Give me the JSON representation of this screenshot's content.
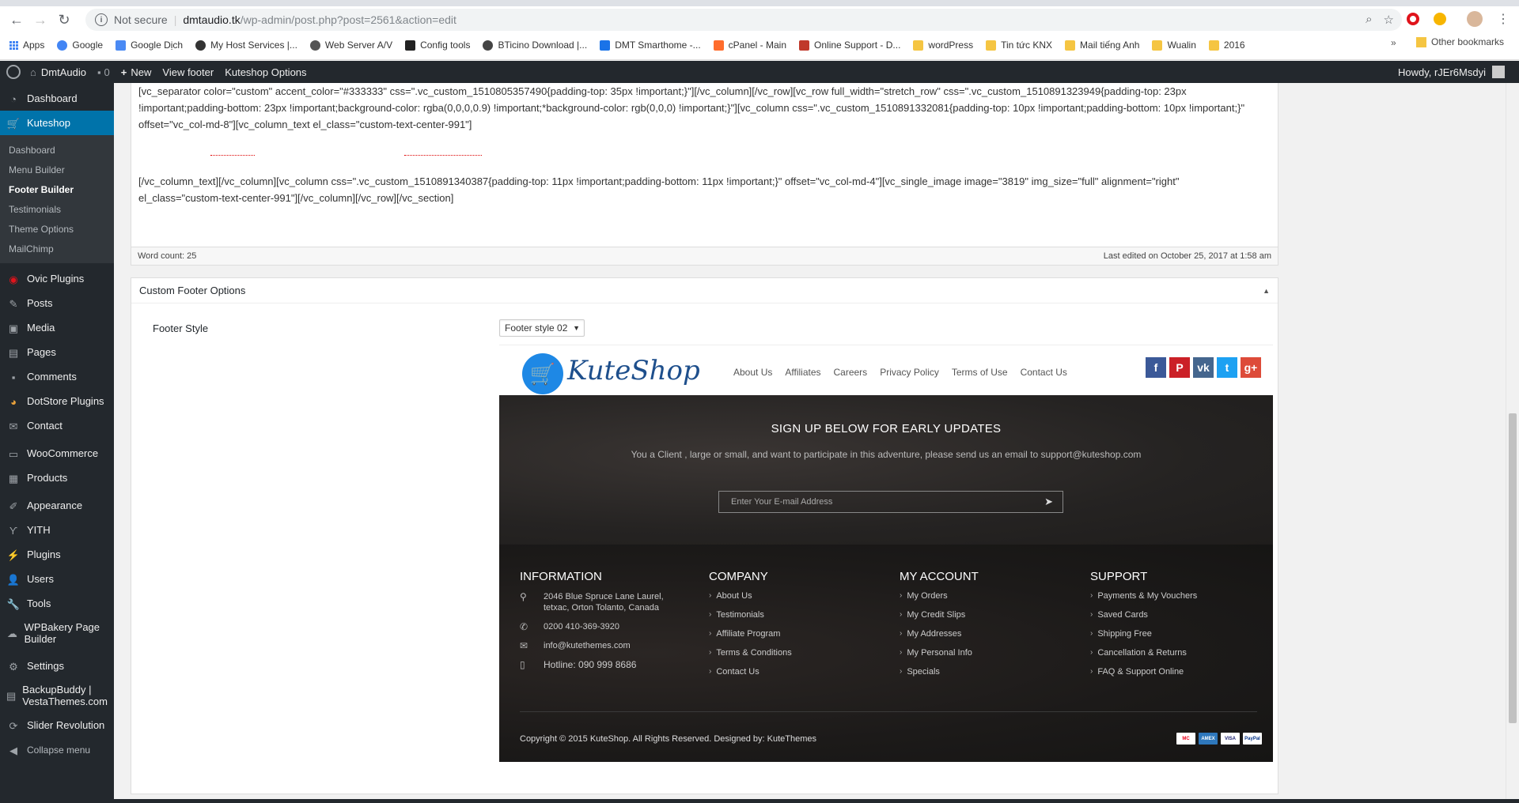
{
  "browser": {
    "security_label": "Not secure",
    "url_host": "dmtaudio.tk",
    "url_path": "/wp-admin/post.php?post=2561&action=edit",
    "bookmarks": [
      {
        "label": "Apps",
        "icon": "apps-grid-icon"
      },
      {
        "label": "Google",
        "icon": "google-icon"
      },
      {
        "label": "Google Dịch",
        "icon": "translate-icon"
      },
      {
        "label": "My Host Services |...",
        "icon": "host-icon"
      },
      {
        "label": "Web Server A/V",
        "icon": "server-icon"
      },
      {
        "label": "Config tools",
        "icon": "page-icon"
      },
      {
        "label": "BTicino Download |...",
        "icon": "bticino-icon"
      },
      {
        "label": "DMT Smarthome -...",
        "icon": "calendar-icon"
      },
      {
        "label": "cPanel - Main",
        "icon": "cpanel-icon"
      },
      {
        "label": "Online Support - D...",
        "icon": "support-icon"
      },
      {
        "label": "wordPress",
        "icon": "folder-icon"
      },
      {
        "label": "Tin tức KNX",
        "icon": "folder-icon"
      },
      {
        "label": "Mail tiếng Anh",
        "icon": "folder-icon"
      },
      {
        "label": "Wualin",
        "icon": "folder-icon"
      },
      {
        "label": "2016",
        "icon": "folder-icon"
      }
    ],
    "other_bookmarks": "Other bookmarks"
  },
  "adminbar": {
    "site_name": "DmtAudio",
    "comments_count": "0",
    "new_label": "New",
    "view_label": "View footer",
    "options_label": "Kuteshop Options",
    "howdy": "Howdy, rJEr6Msdyi"
  },
  "sidebar": {
    "items": [
      {
        "label": "Dashboard",
        "icon": "dashboard-icon"
      },
      {
        "label": "Kuteshop",
        "icon": "cart-icon",
        "active": true
      },
      {
        "label": "Ovic Plugins",
        "icon": "ovic-icon"
      },
      {
        "label": "Posts",
        "icon": "pin-icon"
      },
      {
        "label": "Media",
        "icon": "media-icon"
      },
      {
        "label": "Pages",
        "icon": "pages-icon"
      },
      {
        "label": "Comments",
        "icon": "comment-icon"
      },
      {
        "label": "DotStore Plugins",
        "icon": "dotstore-icon"
      },
      {
        "label": "Contact",
        "icon": "mail-icon"
      },
      {
        "label": "WooCommerce",
        "icon": "woo-icon"
      },
      {
        "label": "Products",
        "icon": "archive-icon"
      },
      {
        "label": "Appearance",
        "icon": "brush-icon"
      },
      {
        "label": "YITH",
        "icon": "yith-icon"
      },
      {
        "label": "Plugins",
        "icon": "plugin-icon"
      },
      {
        "label": "Users",
        "icon": "users-icon"
      },
      {
        "label": "Tools",
        "icon": "wrench-icon"
      },
      {
        "label": "WPBakery Page Builder",
        "icon": "cloud-icon"
      },
      {
        "label": "Settings",
        "icon": "settings-icon"
      },
      {
        "label": "BackupBuddy | VestaThemes.com",
        "icon": "backup-icon"
      },
      {
        "label": "Slider Revolution",
        "icon": "refresh-icon"
      },
      {
        "label": "Collapse menu",
        "icon": "collapse-icon"
      }
    ],
    "submenu": [
      {
        "label": "Dashboard"
      },
      {
        "label": "Menu Builder"
      },
      {
        "label": "Footer Builder",
        "current": true
      },
      {
        "label": "Testimonials"
      },
      {
        "label": "Theme Options"
      },
      {
        "label": "MailChimp"
      }
    ]
  },
  "editor": {
    "code_line1": "[vc_separator color=\"custom\" accent_color=\"#333333\" css=\".vc_custom_1510805357490{padding-top: 35px !important;}\"][/vc_column][/vc_row][vc_row full_width=\"stretch_row\" css=\".vc_custom_1510891323949{padding-top: 23px !important;padding-bottom: 23px !important;background-color: rgba(0,0,0,0.9) !important;*background-color: rgb(0,0,0) !important;}\"][vc_column css=\".vc_custom_1510891332081{padding-top: 10px !important;padding-bottom: 10px !important;}\" offset=\"vc_col-md-8\"][vc_column_text el_class=\"custom-text-center-991\"]",
    "code_line2": "[/vc_column_text][/vc_column][vc_column css=\".vc_custom_1510891340387{padding-top: 11px !important;padding-bottom: 11px !important;}\" offset=\"vc_col-md-4\"][vc_single_image image=\"3819\" img_size=\"full\" alignment=\"right\" el_class=\"custom-text-center-991\"][/vc_column][/vc_row][/vc_section]",
    "word_count": "Word count: 25",
    "last_edited": "Last edited on October 25, 2017 at 1:58 am"
  },
  "metabox": {
    "title": "Custom Footer Options",
    "field_label": "Footer Style",
    "select_value": "Footer style 02"
  },
  "preview": {
    "logo_text": "KuteShop",
    "links": [
      "About Us",
      "Affiliates",
      "Careers",
      "Privacy Policy",
      "Terms of Use",
      "Contact Us"
    ],
    "socials": [
      {
        "glyph": "f",
        "color": "#3b5998",
        "icon": "facebook-icon"
      },
      {
        "glyph": "P",
        "color": "#cb2027",
        "icon": "pinterest-icon"
      },
      {
        "glyph": "vk",
        "color": "#45668e",
        "icon": "vk-icon"
      },
      {
        "glyph": "t",
        "color": "#1da1f2",
        "icon": "twitter-icon"
      },
      {
        "glyph": "g+",
        "color": "#dd4b39",
        "icon": "google-plus-icon"
      }
    ],
    "signup_title": "SIGN UP BELOW FOR EARLY UPDATES",
    "signup_desc": "You a Client , large or small, and want to participate in this adventure, please send us an email to support@kuteshop.com",
    "email_placeholder": "Enter Your E-mail Address",
    "information": {
      "title": "INFORMATION",
      "address": "2046 Blue Spruce Lane Laurel, tetxac, Orton Tolanto, Canada",
      "phone": "0200 410-369-3920",
      "email": "info@kutethemes.com",
      "hotline": "Hotline: 090 999 8686"
    },
    "company": {
      "title": "COMPANY",
      "items": [
        "About Us",
        "Testimonials",
        "Affiliate Program",
        "Terms & Conditions",
        "Contact Us"
      ]
    },
    "account": {
      "title": "MY ACCOUNT",
      "items": [
        "My Orders",
        "My Credit Slips",
        "My Addresses",
        "My Personal Info",
        "Specials"
      ]
    },
    "support": {
      "title": "SUPPORT",
      "items": [
        "Payments & My Vouchers",
        "Saved Cards",
        "Shipping Free",
        "Cancellation & Returns",
        "FAQ & Support Online"
      ]
    },
    "copyright": "Copyright © 2015 KuteShop. All Rights Reserved. Designed by: KuteThemes",
    "payments": [
      {
        "label": "MC",
        "icon": "mastercard-icon"
      },
      {
        "label": "AMEX",
        "icon": "amex-icon"
      },
      {
        "label": "VISA",
        "icon": "visa-icon"
      },
      {
        "label": "PayPal",
        "icon": "paypal-icon"
      }
    ]
  }
}
